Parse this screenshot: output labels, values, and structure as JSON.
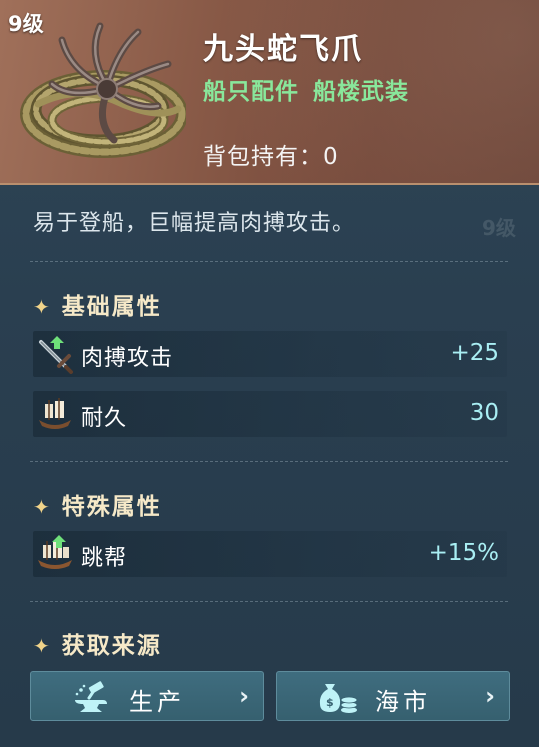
{
  "item": {
    "level": "9级",
    "name": "九头蛇飞爪",
    "tags": [
      "船只配件",
      "船楼武装"
    ],
    "owned_label": "背包持有：",
    "owned_count": "0"
  },
  "ghost": {
    "level": "9级"
  },
  "description": "易于登船，巨幅提高肉搏攻击。",
  "sections": {
    "basic": {
      "title": "基础属性",
      "stats": [
        {
          "icon": "sword-icon",
          "label": "肉搏攻击",
          "value": "+25"
        },
        {
          "icon": "ship-icon",
          "label": "耐久",
          "value": "30"
        }
      ]
    },
    "special": {
      "title": "特殊属性",
      "stats": [
        {
          "icon": "ship-icon",
          "label": "跳帮",
          "value": "+15%"
        }
      ]
    },
    "source": {
      "title": "获取来源",
      "buttons": [
        {
          "icon": "anvil-hammer-icon",
          "label": "生产"
        },
        {
          "icon": "money-bag-coins-icon",
          "label": "海市"
        }
      ]
    }
  },
  "colors": {
    "header_bg": "#8a5b48",
    "panel_bg": "#2a3f50",
    "tag_green": "#89e79b",
    "value_cyan": "#a9eef3",
    "title_cream": "#f6e9c8",
    "button_bg": "#3f6d7f"
  }
}
